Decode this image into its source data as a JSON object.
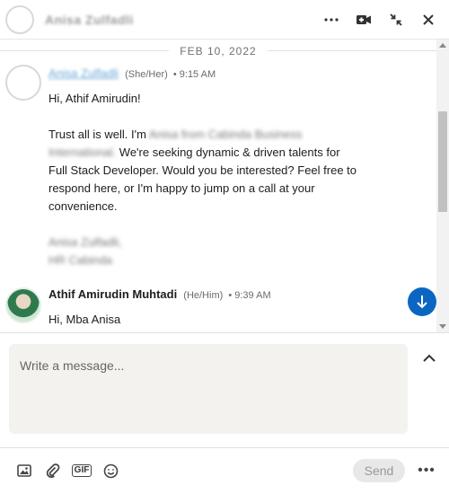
{
  "header": {
    "contact_name": "Anisa Zulfadli",
    "icons": [
      "more-icon",
      "video-call-icon",
      "minimize-icon",
      "close-icon"
    ]
  },
  "thread": {
    "date": "FEB 10, 2022",
    "messages": [
      {
        "sender": "Anisa Zulfadli",
        "pronouns": "(She/Her)",
        "time": "• 9:15 AM",
        "greeting": "Hi, Athif Amirudin!",
        "line1_visible": "Trust all is well. I'm",
        "line1_redacted": "Anisa from Cabinda Business",
        "line2_redacted": "International.",
        "line2_visible": "We're seeking dynamic & driven talents for",
        "line3": "Full Stack Developer. Would you be interested? Feel free to",
        "line4": "respond here, or I'm happy to jump on a call at your",
        "line5": "convenience.",
        "sign1_redacted": "Anisa Zulfadli,",
        "sign2_redacted": "HR Cabinda"
      },
      {
        "sender": "Athif Amirudin Muhtadi",
        "pronouns": "(He/Him)",
        "time": "• 9:39 AM",
        "text": "Hi, Mba Anisa"
      }
    ]
  },
  "compose": {
    "placeholder": "Write a message...",
    "send_label": "Send",
    "more_label": "•••",
    "gif_label": "GIF"
  },
  "colors": {
    "accent": "#0a66c2",
    "compose_bg": "#f4f2ee"
  }
}
